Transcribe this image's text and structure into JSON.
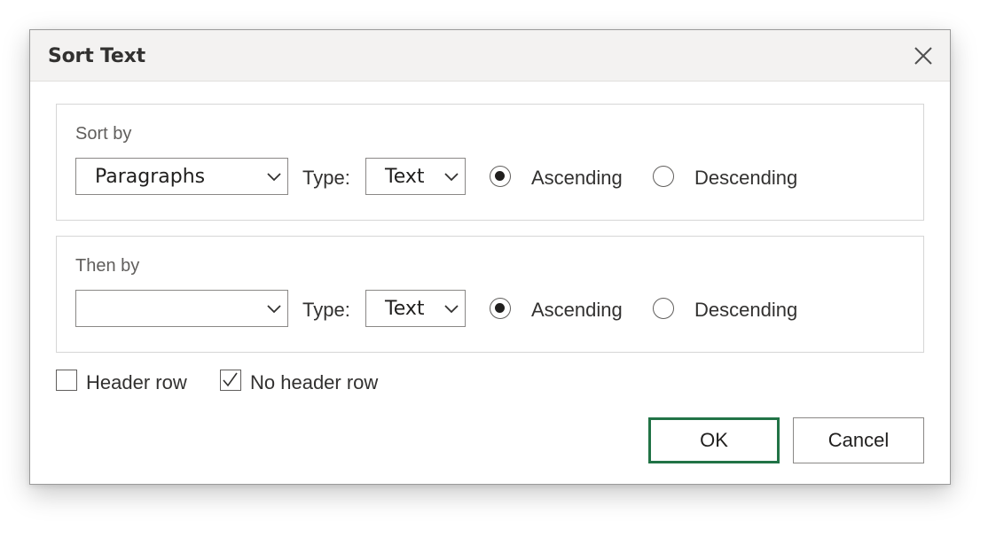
{
  "dialog": {
    "title": "Sort Text"
  },
  "sort_by": {
    "label": "Sort by",
    "field_value": "Paragraphs",
    "type_label": "Type:",
    "type_value": "Text",
    "ascending_label": "Ascending",
    "descending_label": "Descending",
    "order_selected": "Ascending"
  },
  "then_by": {
    "label": "Then by",
    "field_value": "",
    "type_label": "Type:",
    "type_value": "Text",
    "ascending_label": "Ascending",
    "descending_label": "Descending",
    "order_selected": "Ascending"
  },
  "header_options": {
    "header_row_label": "Header row",
    "header_row_checked": false,
    "no_header_row_label": "No header row",
    "no_header_row_checked": true
  },
  "buttons": {
    "ok_label": "OK",
    "cancel_label": "Cancel"
  },
  "colors": {
    "default_button_border": "#217346",
    "titlebar_bg": "#f3f2f1"
  }
}
